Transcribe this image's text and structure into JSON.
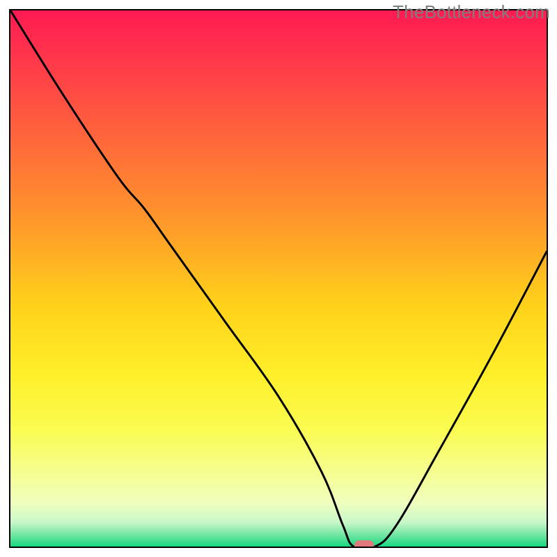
{
  "watermark": "TheBottleneck.com",
  "colors": {
    "frame": "#000000",
    "curve": "#000000",
    "marker": "#e0797b",
    "watermark_text": "#7e7e7e",
    "gradient_stops": [
      {
        "offset": 0.0,
        "color": "#ff1a52"
      },
      {
        "offset": 0.1,
        "color": "#ff3a4a"
      },
      {
        "offset": 0.25,
        "color": "#ff6a3a"
      },
      {
        "offset": 0.4,
        "color": "#ff9a2a"
      },
      {
        "offset": 0.55,
        "color": "#ffd21a"
      },
      {
        "offset": 0.68,
        "color": "#ffef2a"
      },
      {
        "offset": 0.78,
        "color": "#fafc50"
      },
      {
        "offset": 0.86,
        "color": "#f6fe8f"
      },
      {
        "offset": 0.92,
        "color": "#eeffbf"
      },
      {
        "offset": 0.955,
        "color": "#c8f7c8"
      },
      {
        "offset": 0.975,
        "color": "#7de8a8"
      },
      {
        "offset": 1.0,
        "color": "#18d880"
      }
    ]
  },
  "chart_data": {
    "type": "line",
    "title": "",
    "xlabel": "",
    "ylabel": "",
    "xlim": [
      0,
      100
    ],
    "ylim": [
      0,
      100
    ],
    "grid": false,
    "series": [
      {
        "name": "curve",
        "x": [
          0,
          10,
          20,
          25,
          30,
          40,
          50,
          58,
          62,
          64,
          68,
          72,
          80,
          90,
          100
        ],
        "y": [
          100,
          84,
          69,
          63,
          56,
          42,
          28,
          14,
          4,
          0,
          0,
          4,
          18,
          36,
          55
        ]
      }
    ],
    "marker": {
      "x": 66,
      "y": 0
    }
  }
}
